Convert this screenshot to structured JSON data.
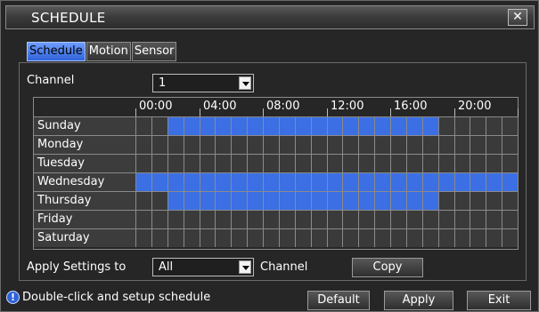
{
  "window": {
    "title": "SCHEDULE",
    "close_glyph": "✕"
  },
  "tabs": [
    {
      "label": "Schedule",
      "active": true
    },
    {
      "label": "Motion",
      "active": false
    },
    {
      "label": "Sensor",
      "active": false
    }
  ],
  "channel": {
    "label": "Channel",
    "value": "1"
  },
  "hours": [
    "00:00",
    "04:00",
    "08:00",
    "12:00",
    "16:00",
    "20:00"
  ],
  "schedule": {
    "slot_count": 24,
    "colors": {
      "on": "#3b6fe3",
      "off": "#3a3a3a"
    },
    "days": [
      {
        "name": "Sunday",
        "on_ranges": [
          [
            2,
            19
          ]
        ]
      },
      {
        "name": "Monday",
        "on_ranges": []
      },
      {
        "name": "Tuesday",
        "on_ranges": []
      },
      {
        "name": "Wednesday",
        "on_ranges": [
          [
            0,
            24
          ]
        ]
      },
      {
        "name": "Thursday",
        "on_ranges": [
          [
            2,
            19
          ]
        ]
      },
      {
        "name": "Friday",
        "on_ranges": []
      },
      {
        "name": "Saturday",
        "on_ranges": []
      }
    ]
  },
  "apply": {
    "label": "Apply Settings to",
    "value": "All",
    "suffix": "Channel",
    "copy_label": "Copy"
  },
  "footer": {
    "hint": "Double-click and setup schedule",
    "info_icon": "info-icon",
    "default_label": "Default",
    "apply_label": "Apply",
    "exit_label": "Exit"
  }
}
